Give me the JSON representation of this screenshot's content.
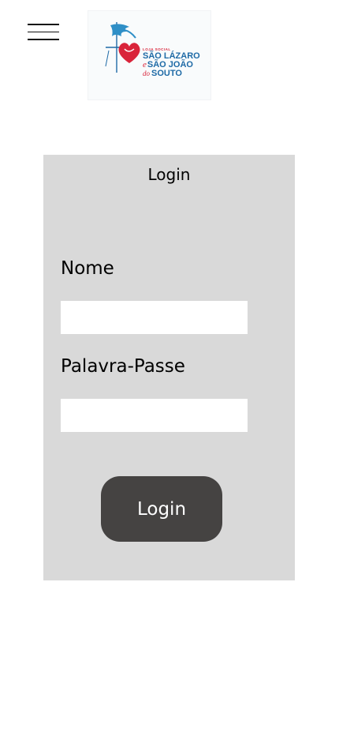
{
  "logo": {
    "tagline": "LOJA SOCIAL",
    "line1": "SÃO LÁZARO",
    "line2_conj": "e",
    "line2": "SÃO JOÃO",
    "line3_prefix": "do",
    "line3": "SOUTO",
    "colors": {
      "blue": "#1e6aa6",
      "red": "#d9243a"
    }
  },
  "menu": {
    "icon": "hamburger-icon"
  },
  "form": {
    "title": "Login",
    "name_label": "Nome",
    "name_value": "",
    "password_label": "Palavra-Passe",
    "password_value": "",
    "submit_label": "Login",
    "colors": {
      "card_bg": "#d9d9d9",
      "button_bg": "#454342",
      "button_text": "#ffffff"
    }
  }
}
